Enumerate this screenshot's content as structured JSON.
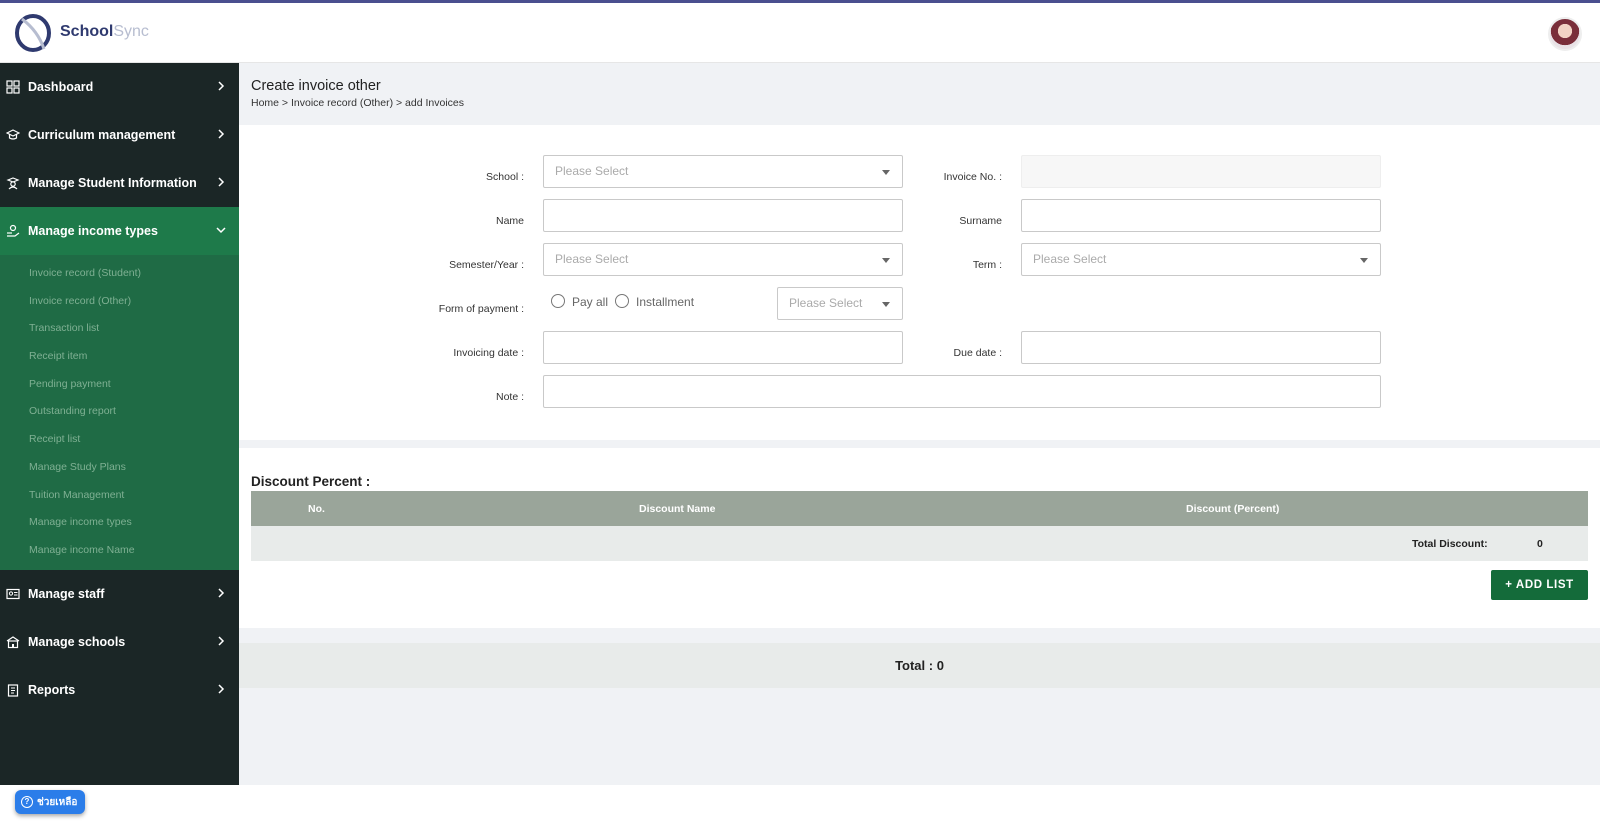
{
  "app": {
    "brand_part1": "School",
    "brand_part2": "Sync"
  },
  "sidebar": {
    "items": [
      {
        "label": "Dashboard"
      },
      {
        "label": "Curriculum management"
      },
      {
        "label": "Manage Student Information"
      },
      {
        "label": "Manage income types"
      },
      {
        "label": "Manage staff"
      },
      {
        "label": "Manage schools"
      },
      {
        "label": "Reports"
      }
    ],
    "submenu": [
      "Invoice record (Student)",
      "Invoice record (Other)",
      "Transaction list",
      "Receipt item",
      "Pending payment",
      "Outstanding report",
      "Receipt list",
      "Manage Study Plans",
      "Tuition Management",
      "Manage income types",
      "Manage income Name"
    ]
  },
  "page": {
    "title": "Create invoice other",
    "breadcrumb": "Home > Invoice record (Other) > add Invoices"
  },
  "form": {
    "school_label": "School :",
    "school_placeholder": "Please Select",
    "invoice_no_label": "Invoice No. :",
    "name_label": "Name",
    "surname_label": "Surname",
    "semester_label": "Semester/Year :",
    "semester_placeholder": "Please Select",
    "term_label": "Term :",
    "term_placeholder": "Please Select",
    "payment_label": "Form of payment :",
    "pay_all_label": "Pay all",
    "installment_label": "Installment",
    "installment_placeholder": "Please Select",
    "invoicing_date_label": "Invoicing date :",
    "due_date_label": "Due date :",
    "note_label": "Note :"
  },
  "discount": {
    "title": "Discount Percent :",
    "col_no": "No.",
    "col_name": "Discount Name",
    "col_percent": "Discount (Percent)",
    "total_label": "Total Discount:",
    "total_value": "0",
    "add_button": "+ ADD LIST"
  },
  "total": {
    "text": "Total : 0"
  },
  "help": {
    "label": "ช่วยเหลือ"
  },
  "colors": {
    "sidebar_bg": "#1b2626",
    "active_green": "#1e7a4a",
    "button_green": "#146b3a",
    "table_header": "#9aa59a"
  }
}
